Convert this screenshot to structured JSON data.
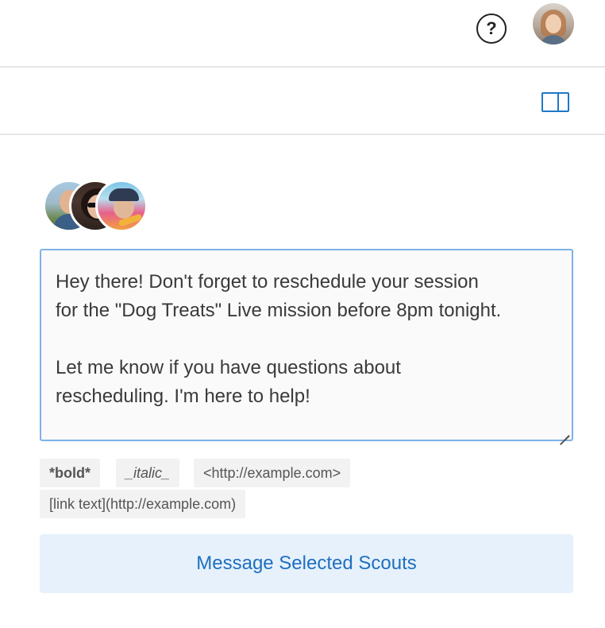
{
  "header": {
    "help_icon_label": "?",
    "icons": {
      "help": "help-circle-icon",
      "avatar": "user-avatar",
      "panel": "sidebar-toggle-icon"
    }
  },
  "recipients": {
    "avatars": [
      "scout-avatar-1",
      "scout-avatar-2",
      "scout-avatar-3"
    ]
  },
  "composer": {
    "message": "Hey there! Don't forget to reschedule your session\nfor the \"Dog Treats\" Live mission before 8pm tonight.\n\nLet me know if you have questions about\nrescheduling. I'm here to help!"
  },
  "formatting_hints": {
    "bold": "*bold*",
    "italic": "_italic_",
    "url": "<http://example.com>",
    "link": "[link text](http://example.com)"
  },
  "actions": {
    "send_label": "Message Selected Scouts"
  },
  "colors": {
    "accent": "#1f6fbf",
    "focus_border": "#7fb1e8",
    "button_bg": "#e6f1fb",
    "hint_bg": "#f2f2f2"
  }
}
